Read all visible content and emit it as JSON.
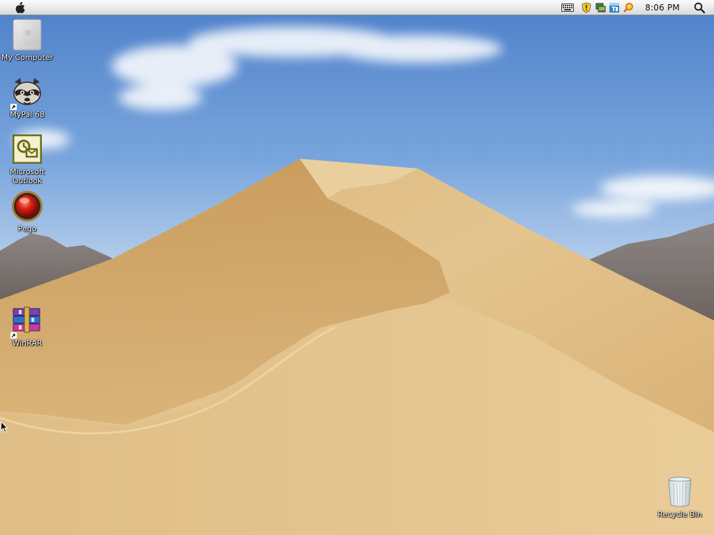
{
  "menubar": {
    "apple_icon": "apple-logo-icon",
    "tray": [
      {
        "name": "keyboard-icon"
      },
      {
        "name": "security-shield-icon"
      },
      {
        "name": "network-icon"
      },
      {
        "name": "tray-app-icon"
      },
      {
        "name": "search-tool-icon"
      }
    ],
    "clock": "8:06 PM",
    "spotlight_icon": "magnifier-icon"
  },
  "desktop": {
    "icons": [
      {
        "label": "My Computer",
        "icon": "computer-icon"
      },
      {
        "label": "MyPal 68",
        "icon": "raccoon-browser-icon"
      },
      {
        "label": "Microsoft\nOutlook",
        "icon": "outlook-icon"
      },
      {
        "label": "Pego",
        "icon": "red-orb-icon"
      },
      {
        "label": "WinRAR",
        "icon": "winrar-books-icon"
      }
    ],
    "recycle_bin": {
      "label": "Recycle Bin",
      "icon": "trash-can-icon"
    }
  },
  "colors": {
    "sky_top": "#5f8fd0",
    "sand_light": "#e6c895",
    "sand_shadow": "#c99a5a",
    "menubar": "#ececec"
  }
}
